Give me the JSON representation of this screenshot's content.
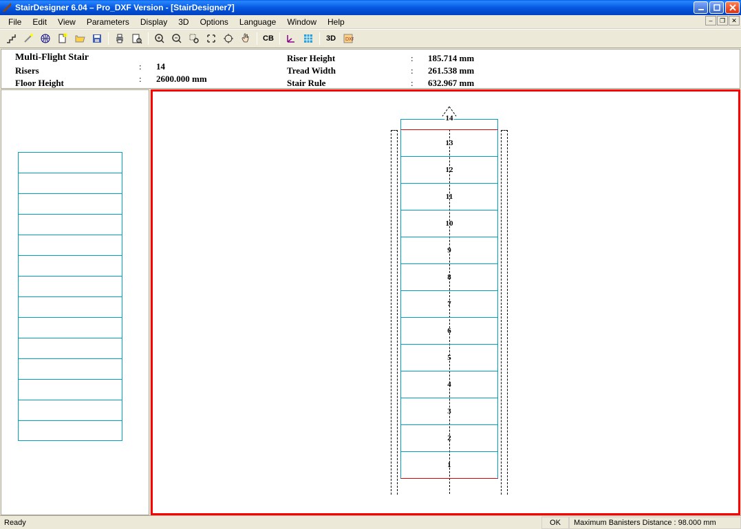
{
  "title": "StairDesigner 6.04 – Pro_DXF Version - [StairDesigner7]",
  "menu": {
    "file": "File",
    "edit": "Edit",
    "view": "View",
    "parameters": "Parameters",
    "display": "Display",
    "three_d": "3D",
    "options": "Options",
    "language": "Language",
    "window": "Window",
    "help": "Help"
  },
  "info": {
    "heading": "Multi-Flight Stair",
    "risers_label": "Risers",
    "risers_val": "14",
    "floor_height_label": "Floor Height",
    "floor_height_val": "2600.000 mm",
    "riser_height_label": "Riser Height",
    "riser_height_val": "185.714 mm",
    "tread_width_label": "Tread Width",
    "tread_width_val": "261.538 mm",
    "stair_rule_label": "Stair Rule",
    "stair_rule_val": "632.967 mm",
    "colon": ":"
  },
  "steps": [
    "14",
    "13",
    "12",
    "11",
    "10",
    "9",
    "8",
    "7",
    "6",
    "5",
    "4",
    "3",
    "2",
    "1"
  ],
  "toolbar": {
    "cb": "CB",
    "three_d": "3D"
  },
  "status": {
    "ready": "Ready",
    "ok": "OK",
    "dist": "Maximum Banisters Distance : 98.000 mm"
  }
}
